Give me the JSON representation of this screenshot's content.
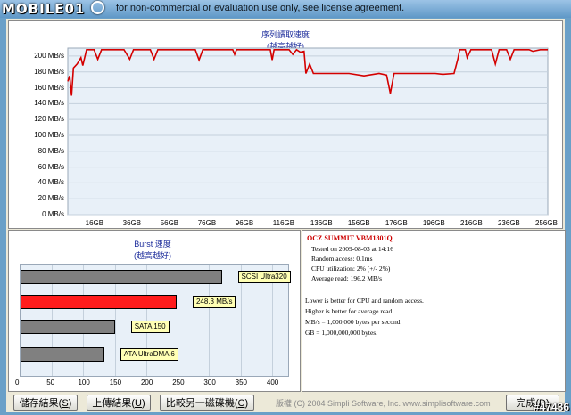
{
  "watermark": {
    "text": "MOBILE01"
  },
  "window": {
    "title_fragment": "for non-commercial or evaluation use only, see license agreement."
  },
  "read_chart": {
    "title_line1": "序列讀取速度",
    "title_line2": "(越高越好)",
    "y_ticks": [
      "200 MB/s",
      "180 MB/s",
      "160 MB/s",
      "140 MB/s",
      "120 MB/s",
      "100 MB/s",
      "80 MB/s",
      "60 MB/s",
      "40 MB/s",
      "20 MB/s",
      "0 MB/s"
    ],
    "x_ticks": [
      "16GB",
      "36GB",
      "56GB",
      "76GB",
      "96GB",
      "116GB",
      "136GB",
      "156GB",
      "176GB",
      "196GB",
      "216GB",
      "236GB",
      "256GB"
    ],
    "line_color": "#d40000"
  },
  "chart_data": [
    {
      "type": "line",
      "title": "序列讀取速度 (越高越好)",
      "xlabel": "",
      "ylabel": "",
      "xlim": [
        0,
        256
      ],
      "ylim": [
        0,
        210
      ],
      "series": [
        {
          "values": [
            [
              0,
              168
            ],
            [
              1,
              175
            ],
            [
              2,
              150
            ],
            [
              3,
              185
            ],
            [
              5,
              190
            ],
            [
              7,
              198
            ],
            [
              8,
              188
            ],
            [
              10,
              208
            ],
            [
              14,
              208
            ],
            [
              16,
              196
            ],
            [
              18,
              208
            ],
            [
              30,
              208
            ],
            [
              33,
              196
            ],
            [
              35,
              208
            ],
            [
              44,
              208
            ],
            [
              46,
              196
            ],
            [
              48,
              208
            ],
            [
              68,
              208
            ],
            [
              70,
              195
            ],
            [
              72,
              208
            ],
            [
              88,
              208
            ],
            [
              89,
              202
            ],
            [
              90,
              208
            ],
            [
              108,
              208
            ],
            [
              109,
              195
            ],
            [
              110,
              208
            ],
            [
              118,
              208
            ],
            [
              120,
              202
            ],
            [
              122,
              208
            ],
            [
              124,
              205
            ],
            [
              126,
              206
            ],
            [
              127,
              178
            ],
            [
              129,
              190
            ],
            [
              131,
              178
            ],
            [
              150,
              178
            ],
            [
              158,
              175
            ],
            [
              166,
              178
            ],
            [
              170,
              176
            ],
            [
              172,
              153
            ],
            [
              174,
              178
            ],
            [
              196,
              178
            ],
            [
              200,
              177
            ],
            [
              206,
              178
            ],
            [
              208,
              196
            ],
            [
              209,
              208
            ],
            [
              212,
              208
            ],
            [
              213,
              198
            ],
            [
              215,
              208
            ],
            [
              226,
              208
            ],
            [
              228,
              190
            ],
            [
              230,
              208
            ],
            [
              234,
              208
            ],
            [
              236,
              196
            ],
            [
              238,
              208
            ],
            [
              246,
              208
            ],
            [
              248,
              206
            ],
            [
              252,
              208
            ],
            [
              256,
              208
            ]
          ]
        }
      ]
    },
    {
      "type": "bar",
      "title": "Burst 速度 (越高越好)",
      "categories": [
        "SCSI Ultra320",
        "248.3 MB/s",
        "SATA 150",
        "ATA UltraDMA 6"
      ],
      "values": [
        320,
        248.3,
        150,
        133
      ],
      "xlim": [
        0,
        420
      ],
      "x_ticks": [
        0,
        50,
        100,
        150,
        200,
        250,
        300,
        350,
        400
      ],
      "highlight_index": 1
    }
  ],
  "burst_chart": {
    "title_line1": "Burst 速度",
    "title_line2": "(越高越好)",
    "x_ticks": [
      "0",
      "50",
      "100",
      "150",
      "200",
      "250",
      "300",
      "350",
      "400"
    ],
    "bars": [
      {
        "label": "SCSI Ultra320",
        "value": 320,
        "color": "#808080"
      },
      {
        "label": "248.3 MB/s",
        "value": 248.3,
        "color": "#ff1c1c"
      },
      {
        "label": "SATA 150",
        "value": 150,
        "color": "#808080"
      },
      {
        "label": "ATA UltraDMA 6",
        "value": 133,
        "color": "#808080"
      }
    ]
  },
  "info": {
    "drive": "OCZ SUMMIT VBM1801Q",
    "tested_on": "Tested on 2009-08-03 at 14:16",
    "random_access": "Random access: 0.1ms",
    "cpu": "CPU utilization: 2% (+/- 2%)",
    "avg_read": "Average read: 196.2 MB/s",
    "note1": "Lower is better for CPU and random access.",
    "note2": "Higher is better for average read.",
    "note3": "MB/s = 1,000,000 bytes per second.",
    "note4": "GB = 1,000,000,000 bytes."
  },
  "buttons": {
    "save": "儲存結果",
    "save_key": "S",
    "upload": "上傳結果",
    "upload_key": "U",
    "compare": "比較另一磁碟機",
    "compare_key": "C",
    "done": "完成",
    "done_key": "D"
  },
  "footer": {
    "copyright": "版權 (C) 2004 Simpli Software, Inc. www.simplisoftware.com"
  },
  "stamp": {
    "text": "#47436"
  }
}
